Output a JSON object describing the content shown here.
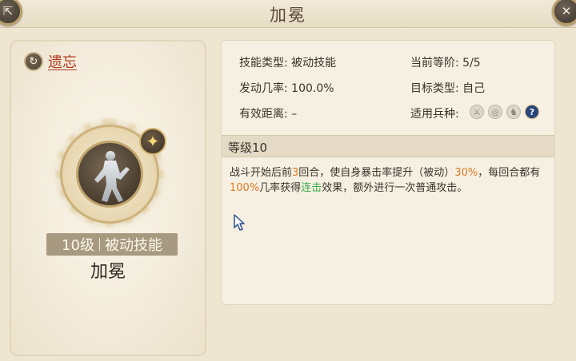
{
  "window": {
    "title": "加冕"
  },
  "left_panel": {
    "forget_label": "遗忘",
    "level_text": "10级",
    "type_text": "被动技能",
    "skill_name": "加冕"
  },
  "info": {
    "skill_type_label": "技能类型:",
    "skill_type_value": "被动技能",
    "current_rank_label": "当前等阶:",
    "current_rank_value": "5/5",
    "trigger_rate_label": "发动几率:",
    "trigger_rate_value": "100.0%",
    "target_type_label": "目标类型:",
    "target_type_value": "自己",
    "range_label": "有效距离:",
    "range_value": "–",
    "unit_types_label": "适用兵种:",
    "unit_icons": [
      "sword-icon",
      "bow-icon",
      "horse-icon",
      "help-icon"
    ],
    "help_glyph": "?"
  },
  "level_header": "等级10",
  "description": {
    "p1": "战斗开始后前",
    "n1": "3",
    "p2": "回合，使自身暴击率提升（被动）",
    "n2": "30%",
    "p3": "，每回合都有",
    "n3": "100%",
    "p4": "几率获得",
    "kw": "连击",
    "p5": "效果，额外进行一次普通攻击。"
  },
  "colors": {
    "highlight_orange": "#e07a26",
    "highlight_green": "#3fa84a",
    "forget_red": "#b23a1e"
  }
}
